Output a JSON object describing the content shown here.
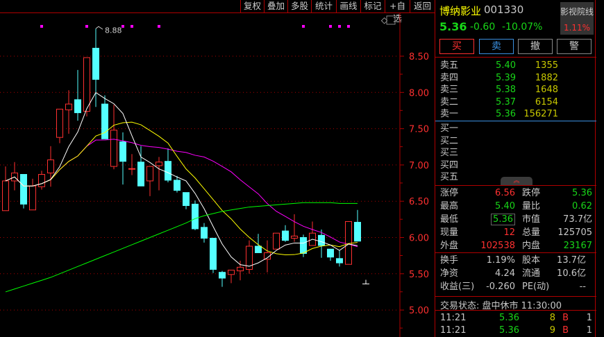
{
  "toolbar": {
    "items": [
      "复权",
      "叠加",
      "多股",
      "统计",
      "画线",
      "标记",
      "+自选",
      "返回"
    ]
  },
  "quote": {
    "name": "博纳影业",
    "code": "001330",
    "price": "5.36",
    "change": "-0.60",
    "change_pct": "-10.07%",
    "sector": "影视院线",
    "sector_pct": "1.11%"
  },
  "actions": {
    "buy": "买",
    "sell": "卖",
    "cancel": "撤",
    "alert": "警"
  },
  "asks": [
    {
      "label": "卖五",
      "price": "5.40",
      "vol": "1355"
    },
    {
      "label": "卖四",
      "price": "5.39",
      "vol": "1882"
    },
    {
      "label": "卖三",
      "price": "5.38",
      "vol": "1648"
    },
    {
      "label": "卖二",
      "price": "5.37",
      "vol": "6154"
    },
    {
      "label": "卖一",
      "price": "5.36",
      "vol": "156271"
    }
  ],
  "bids": [
    {
      "label": "买一"
    },
    {
      "label": "买二"
    },
    {
      "label": "买三"
    },
    {
      "label": "买四"
    },
    {
      "label": "买五"
    }
  ],
  "collapse_icon": "chevron-up-icon",
  "stats1": [
    {
      "l1": "涨停",
      "v1": "6.56",
      "l2": "跌停",
      "v2": "5.36"
    },
    {
      "l1": "最高",
      "v1": "5.40",
      "l2": "量比",
      "v2": "0.62"
    },
    {
      "l1": "最低",
      "v1": "5.36",
      "l2": "市值",
      "v2": "73.7亿"
    },
    {
      "l1": "现量",
      "v1": "12",
      "l2": "总量",
      "v2": "125705"
    },
    {
      "l1": "外盘",
      "v1": "102538",
      "l2": "内盘",
      "v2": "23167"
    }
  ],
  "stats2": [
    {
      "l1": "换手",
      "v1": "1.19%",
      "l2": "股本",
      "v2": "13.7亿"
    },
    {
      "l1": "净资",
      "v1": "4.24",
      "l2": "流通",
      "v2": "10.6亿"
    },
    {
      "l1": "收益(三)",
      "v1": "-0.260",
      "l2": "PE(动)",
      "v2": "--"
    }
  ],
  "status": "交易状态: 盘中休市 11:30:00",
  "ticks": [
    {
      "time": "11:21",
      "price": "5.36",
      "vol": "8",
      "side": "B",
      "n": "1"
    },
    {
      "time": "11:21",
      "price": "5.36",
      "vol": "9",
      "side": "B",
      "n": "1"
    }
  ],
  "colors": {
    "up": "#ff3030",
    "down": "#54ffff",
    "ma5": "#ffffff",
    "ma10": "#ffff00",
    "ma20": "#ff00ff",
    "ma60": "#00ff00",
    "grid": "#b00000"
  },
  "chart_data": {
    "type": "candlestick",
    "y_ticks": [
      "8.50",
      "8.00",
      "7.50",
      "7.00",
      "6.50",
      "6.00",
      "5.50",
      "5.00"
    ],
    "ylim": [
      4.78,
      8.95
    ],
    "high_label": "8.88",
    "ohlc": [
      [
        6.37,
        6.98,
        6.37,
        6.78
      ],
      [
        6.78,
        7.04,
        6.65,
        6.89
      ],
      [
        6.87,
        6.87,
        6.4,
        6.46
      ],
      [
        6.38,
        6.81,
        6.38,
        6.71
      ],
      [
        6.7,
        6.92,
        6.66,
        6.87
      ],
      [
        6.89,
        7.26,
        6.7,
        7.07
      ],
      [
        7.38,
        7.77,
        7.3,
        7.77
      ],
      [
        7.76,
        8.03,
        7.43,
        7.84
      ],
      [
        7.9,
        8.31,
        7.61,
        7.72
      ],
      [
        7.74,
        8.48,
        7.67,
        8.48
      ],
      [
        8.61,
        8.88,
        7.8,
        8.18
      ],
      [
        7.84,
        7.96,
        7.36,
        7.36
      ],
      [
        6.98,
        7.83,
        6.94,
        7.48
      ],
      [
        7.32,
        7.45,
        6.73,
        7.05
      ],
      [
        6.95,
        7.15,
        6.86,
        6.95
      ],
      [
        7.04,
        7.26,
        6.71,
        6.71
      ],
      [
        6.78,
        6.98,
        6.57,
        6.98
      ],
      [
        6.99,
        7.11,
        6.65,
        7.04
      ],
      [
        7.05,
        7.23,
        6.76,
        6.79
      ],
      [
        6.79,
        6.85,
        6.62,
        6.65
      ],
      [
        6.62,
        6.62,
        6.39,
        6.44
      ],
      [
        6.46,
        6.51,
        6.1,
        6.12
      ],
      [
        6.14,
        6.2,
        5.93,
        5.99
      ],
      [
        5.99,
        5.99,
        5.51,
        5.56
      ],
      [
        5.52,
        5.54,
        5.32,
        5.44
      ],
      [
        5.49,
        5.55,
        5.37,
        5.55
      ],
      [
        5.54,
        5.68,
        5.41,
        5.59
      ],
      [
        5.56,
        5.96,
        5.5,
        5.88
      ],
      [
        5.88,
        6.05,
        5.79,
        5.79
      ],
      [
        5.7,
        5.96,
        5.52,
        5.79
      ],
      [
        5.84,
        6.06,
        5.84,
        6.06
      ],
      [
        6.09,
        6.17,
        5.94,
        5.96
      ],
      [
        5.99,
        6.32,
        5.94,
        6.02
      ],
      [
        6.0,
        6.04,
        5.73,
        5.78
      ],
      [
        5.89,
        6.22,
        5.89,
        6.06
      ],
      [
        6.03,
        6.11,
        5.72,
        5.89
      ],
      [
        5.84,
        5.84,
        5.68,
        5.73
      ],
      [
        5.71,
        5.82,
        5.6,
        5.65
      ],
      [
        5.63,
        6.22,
        5.63,
        6.22
      ],
      [
        6.21,
        6.38,
        5.95,
        5.95
      ]
    ],
    "ma60": [
      5.25,
      5.29,
      5.33,
      5.37,
      5.41,
      5.45,
      5.5,
      5.55,
      5.6,
      5.65,
      5.7,
      5.75,
      5.8,
      5.85,
      5.9,
      5.95,
      6.0,
      6.05,
      6.1,
      6.15,
      6.2,
      6.26,
      6.3,
      6.33,
      6.36,
      6.38,
      6.4,
      6.42,
      6.43,
      6.44,
      6.45,
      6.46,
      6.47,
      6.48,
      6.48,
      6.48,
      6.48,
      6.47,
      6.47,
      6.47
    ],
    "signal_markers": [
      4,
      9,
      13,
      14,
      17,
      33,
      36,
      37,
      38
    ],
    "current_price_marker": 5.36
  }
}
